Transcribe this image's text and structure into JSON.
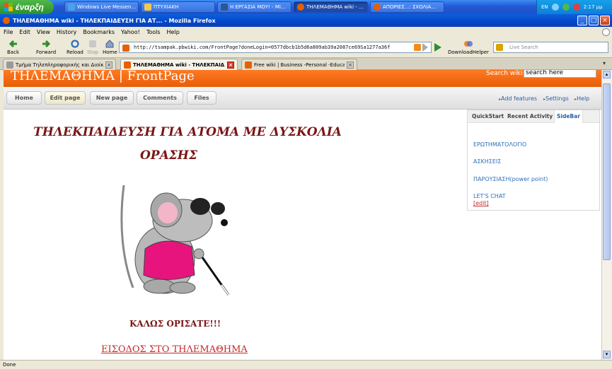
{
  "taskbar": {
    "start_label": "έναρξη",
    "buttons": [
      {
        "label": "Windows Live Messen..."
      },
      {
        "label": "ΠΤΥΧΙΑΚΗ"
      },
      {
        "label": "Η ΕΡΓΑΣΙΑ ΜΟΥ! - Mi..."
      },
      {
        "label": "ΤΗΛΕΜΑΘΗΜΑ wiki - ..."
      },
      {
        "label": "ΑΠΟΡΙΕΣ...: ΣΧΟΛΙΑ..."
      }
    ],
    "lang": "EN",
    "clock": "2:17 μμ"
  },
  "window": {
    "title": "ΤΗΛΕΜΑΘΗΜΑ wiki - ΤΗΛΕΚΠΑΙΔΕΥΣΗ ΓΙΑ ΑΤ... - Mozilla Firefox"
  },
  "menu": [
    "File",
    "Edit",
    "View",
    "History",
    "Bookmarks",
    "Yahoo!",
    "Tools",
    "Help"
  ],
  "toolbar": {
    "back": "Back",
    "forward": "Forward",
    "reload": "Reload",
    "stop": "Stop",
    "home": "Home",
    "url": "http://tsampak.pbwiki.com/FrontPage?doneLogin=0577dbcb1b5d6a809ab39a2087ce69Sa1277a36f",
    "downloadhelper": "DownloadHelper",
    "search_placeholder": "Live Search"
  },
  "tabs": [
    {
      "label": "Τμήμα Τηλεπληροφορικής και Διοίκησ..."
    },
    {
      "label": "ΤΗΛΕΜΑΘΗΜΑ wiki - ΤΗΛΕΚΠΑΙΔ..."
    },
    {
      "label": "Free wiki | Business -Personal -Educati..."
    }
  ],
  "wiki": {
    "site_title": "ΤΗΛΕΜΑΘΗΜΑ | FrontPage",
    "search_label": "Search wiki:",
    "search_value": "search here",
    "nav": [
      "Home",
      "Edit page",
      "New page",
      "Comments",
      "Files"
    ],
    "right_links": [
      "Add features",
      "Settings",
      "Help"
    ],
    "heading_line1": "ΤΗΛΕΚΠΑΙΔΕΥΣΗ ΓΙΑ ΑΤΟΜΑ ΜΕ ΔΥΣΚΟΛΙΑ",
    "heading_line2": "ΟΡΑΣΗΣ",
    "welcome": "ΚΑΛΩΣ ΟΡΙΣΑΤΕ!!!",
    "enter_link": "ΕΙΣΟΔΟΣ ΣΤΟ ΤΗΛΕΜΑΘΗΜΑ",
    "sidebar": {
      "tabs": [
        "QuickStart",
        "Recent Activity",
        "SideBar"
      ],
      "links": [
        "ΕΡΩΤΗΜΑΤΟΛΟΓΙΟ",
        "ΑΣΚΗΣΕΙΣ",
        "ΠΑΡΟΥΣΙΑΣΗ(power point)",
        "LET'S CHAT"
      ],
      "edit": "[edit]"
    }
  },
  "status": "Done",
  "colors": {
    "wiki_orange": "#f06a10",
    "heading_red": "#7a1414",
    "link_blue": "#2a6fb8"
  }
}
